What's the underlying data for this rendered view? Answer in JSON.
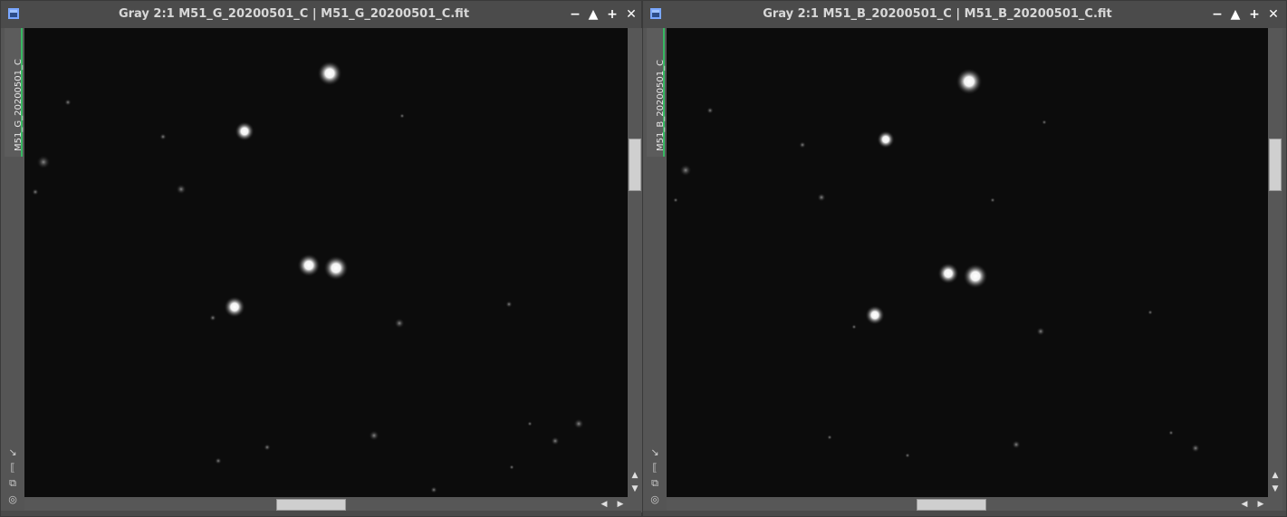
{
  "left": {
    "title": "Gray 2:1 M51_G_20200501_C | M51_G_20200501_C.fit",
    "tab_label": "M51_G_20200501_C"
  },
  "right": {
    "title": "Gray 2:1 M51_B_20200501_C | M51_B_20200501_C.fit",
    "tab_label": "M51_B_20200501_C"
  },
  "icons": {
    "window": "window-icon",
    "minimize": "minimize-icon",
    "shade": "shade-icon",
    "maximize": "maximize-icon",
    "close": "close-icon",
    "fit": "zoom-to-fit-icon",
    "fullsize": "zoom-actual-icon",
    "clone": "clone-view-icon",
    "target": "target-icon"
  },
  "colors": {
    "tab_accent": "#38b862",
    "window_icon": "#7aa7ff",
    "canvas_bg": "#0b0b0b"
  }
}
